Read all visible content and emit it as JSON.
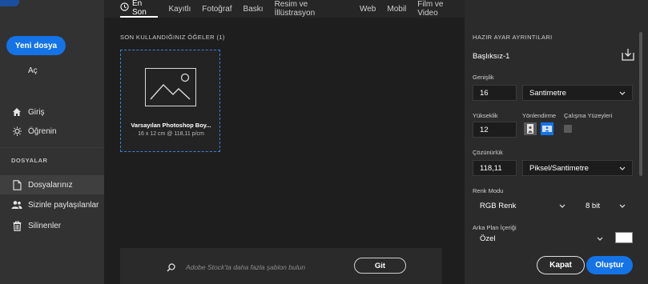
{
  "tabs": [
    {
      "label": "En Son",
      "active": true
    },
    {
      "label": "Kayıtlı"
    },
    {
      "label": "Fotoğraf"
    },
    {
      "label": "Baskı"
    },
    {
      "label": "Resim ve İllüstrasyon"
    },
    {
      "label": "Web"
    },
    {
      "label": "Mobil"
    },
    {
      "label": "Film ve Video"
    }
  ],
  "sidebar": {
    "new_file": "Yeni dosya",
    "open": "Aç",
    "home": "Giriş",
    "learn": "Öğrenin",
    "section_files": "DOSYALAR",
    "your_files": "Dosyalarınız",
    "shared": "Sizinle paylaşılanlar",
    "deleted": "Silinenler"
  },
  "main": {
    "recent_title": "SON KULLANDIĞINIZ ÖĞELER",
    "recent_count": "(1)",
    "card": {
      "title": "Varsayılan Photoshop Boy...",
      "subtitle": "16 x 12 cm @ 118,11 p/cm"
    },
    "search_placeholder": "Adobe Stock'ta daha fazla şablon bulun",
    "go_button": "Git"
  },
  "panel": {
    "header": "HAZIR AYAR AYRINTILARI",
    "preset_name": "Başlıksız-1",
    "width_label": "Genişlik",
    "width_value": "16",
    "width_unit": "Santimetre",
    "height_label": "Yükseklik",
    "height_value": "12",
    "orientation_label": "Yönlendirme",
    "artboards_label": "Çalışma Yüzeyleri",
    "resolution_label": "Çözünürlük",
    "resolution_value": "118,11",
    "resolution_unit": "Piksel/Santimetre",
    "color_mode_label": "Renk Modu",
    "color_mode_value": "RGB Renk",
    "bit_depth": "8 bit",
    "background_label": "Arka Plan İçeriği",
    "background_value": "Özel",
    "background_color": "#ffffff",
    "close_button": "Kapat",
    "create_button": "Oluştur"
  },
  "colors": {
    "accent": "#1473e6",
    "sidebar_bg": "#323232",
    "main_bg": "#1e1e1e",
    "panel_bg": "#2b2b2b"
  }
}
